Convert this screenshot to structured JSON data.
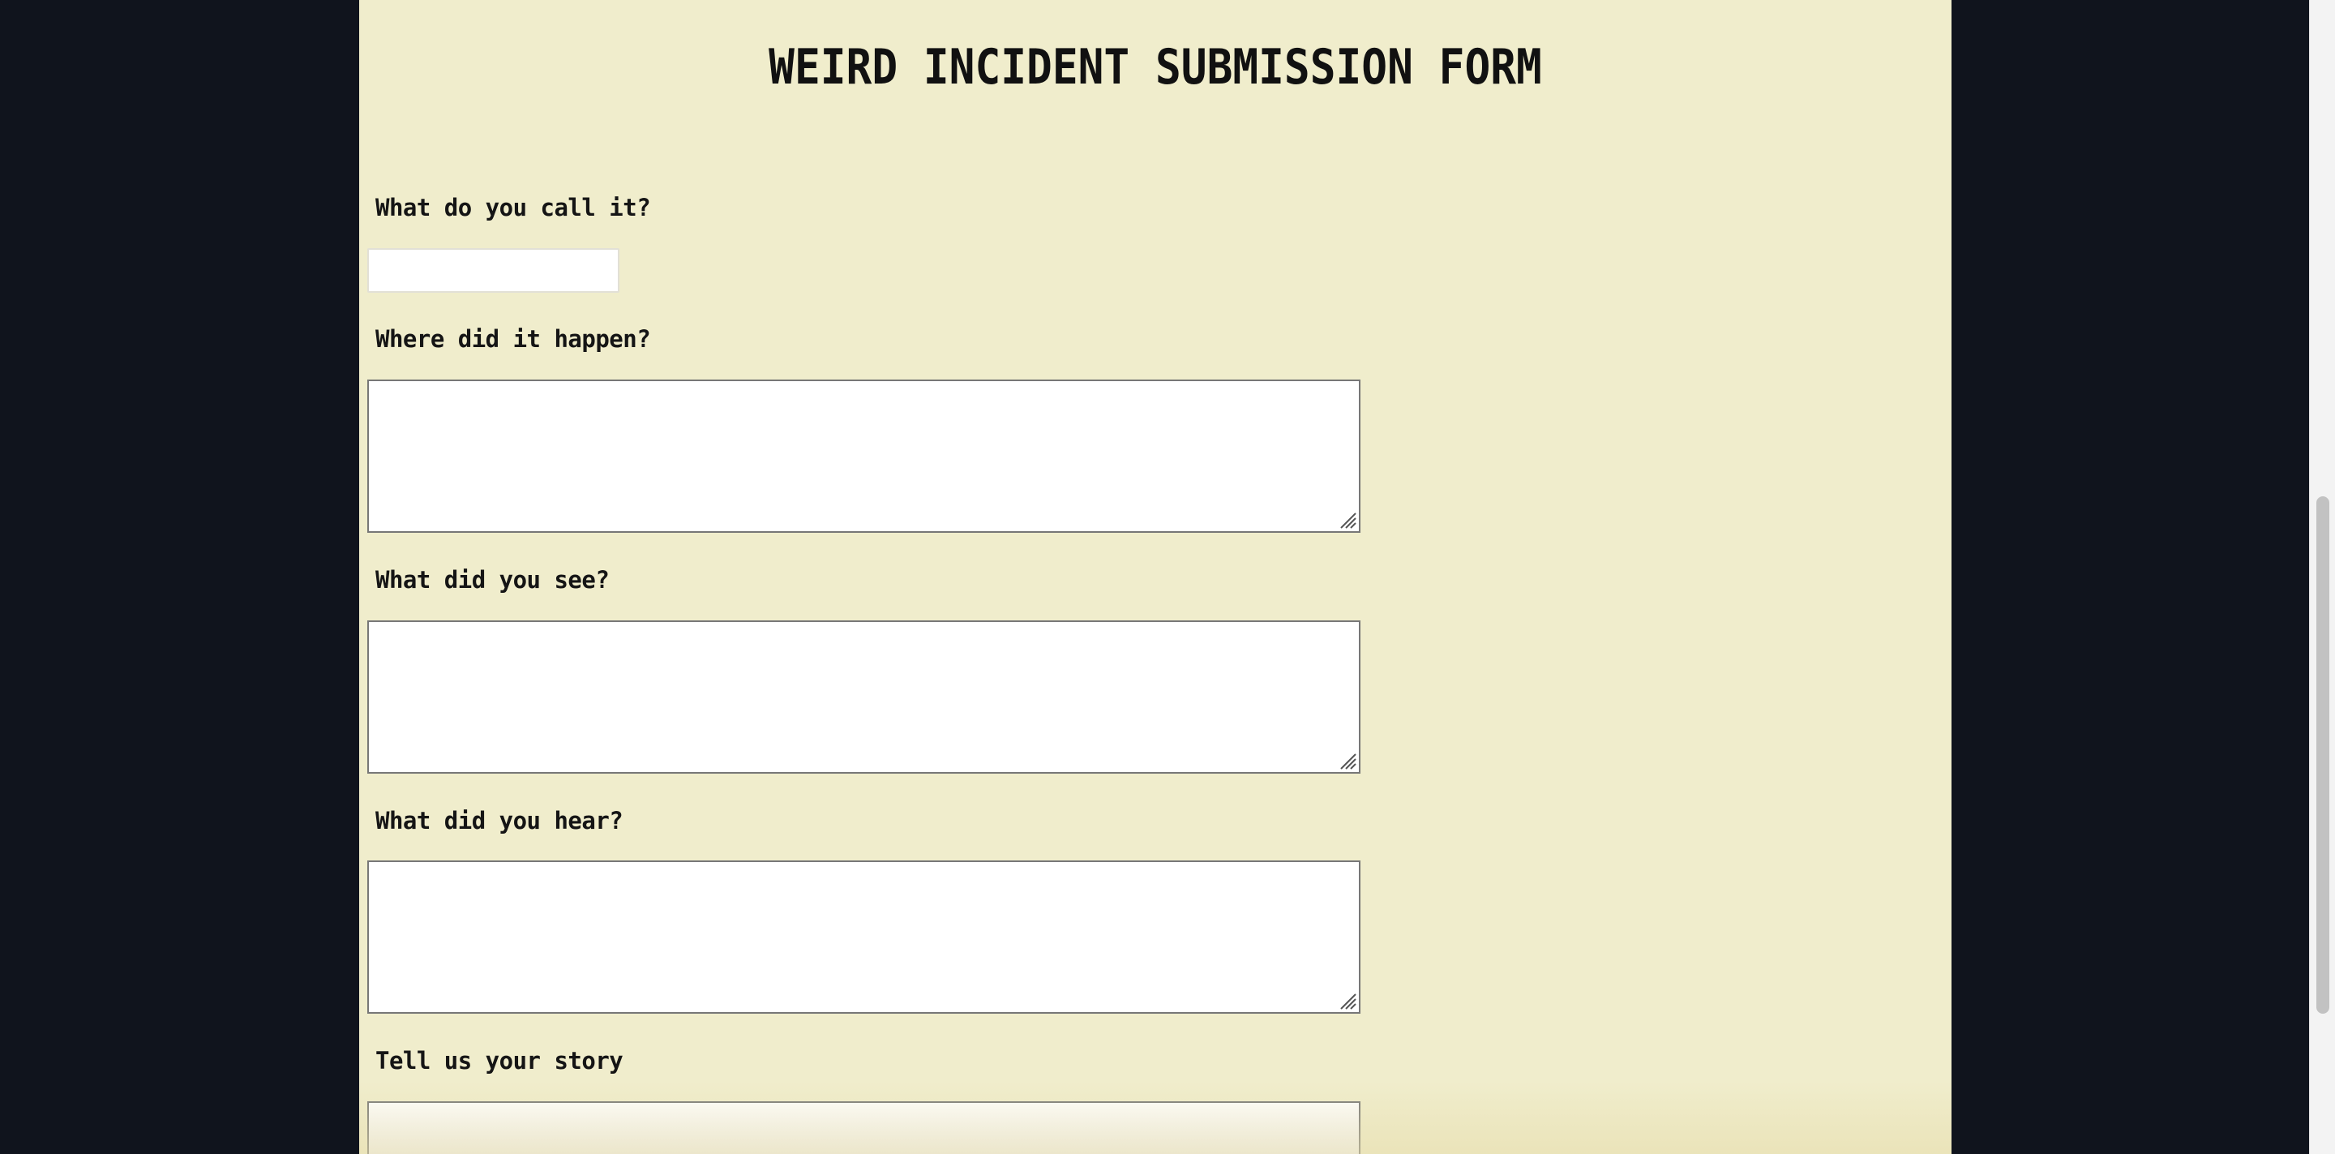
{
  "form": {
    "title": "WEIRD INCIDENT SUBMISSION FORM",
    "fields": [
      {
        "label": "What do you call it?",
        "value": "",
        "type": "text"
      },
      {
        "label": "Where did it happen?",
        "value": "",
        "type": "textarea"
      },
      {
        "label": "What did you see?",
        "value": "",
        "type": "textarea"
      },
      {
        "label": "What did you hear?",
        "value": "",
        "type": "textarea"
      },
      {
        "label": "Tell us your story",
        "value": "",
        "type": "textarea"
      }
    ]
  },
  "colors": {
    "background": "#10141d",
    "page": "#f0edcc",
    "text": "#151515"
  },
  "icons": {
    "resize_grip": "resize-grip-icon"
  }
}
